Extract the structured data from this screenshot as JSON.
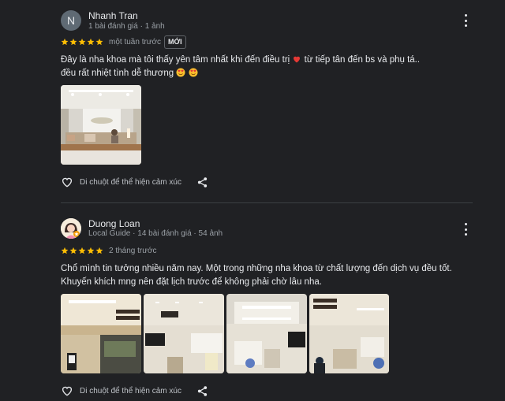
{
  "reviews": [
    {
      "avatar_letter": "N",
      "name": "Nhanh Tran",
      "meta": "1 bài đánh giá · 1 ảnh",
      "rating": 5,
      "ago": "một tuần trước",
      "badge": "MỚI",
      "text_line1_a": "Đây là nha khoa mà tôi thấy yên tâm nhất khi đến điều trị",
      "text_line1_b": "từ tiếp tân đến bs và phụ tá..",
      "text_line2": "đều rất nhiệt tình dễ thương",
      "react_label": "Di chuột để thể hiện cảm xúc"
    },
    {
      "name": "Duong Loan",
      "meta": "Local Guide · 14 bài đánh giá · 54 ảnh",
      "rating": 5,
      "ago": "2 tháng trước",
      "text": "Chổ mình tin tưởng nhiều năm nay. Một trong những nha khoa từ chất lượng đến dịch vụ đều tốt. Khuyến khích mng nên đặt lịch trước để không phải chờ lâu nha.",
      "react_label": "Di chuột để thể hiện cảm xúc"
    }
  ],
  "colors": {
    "star": "#fbbc04",
    "heart": "#e53935",
    "bg": "#202124"
  },
  "icons": [
    "more-vert-icon",
    "star-icon",
    "heart-outline-icon",
    "share-icon",
    "heart-emoji",
    "smile-hearts-emoji"
  ]
}
